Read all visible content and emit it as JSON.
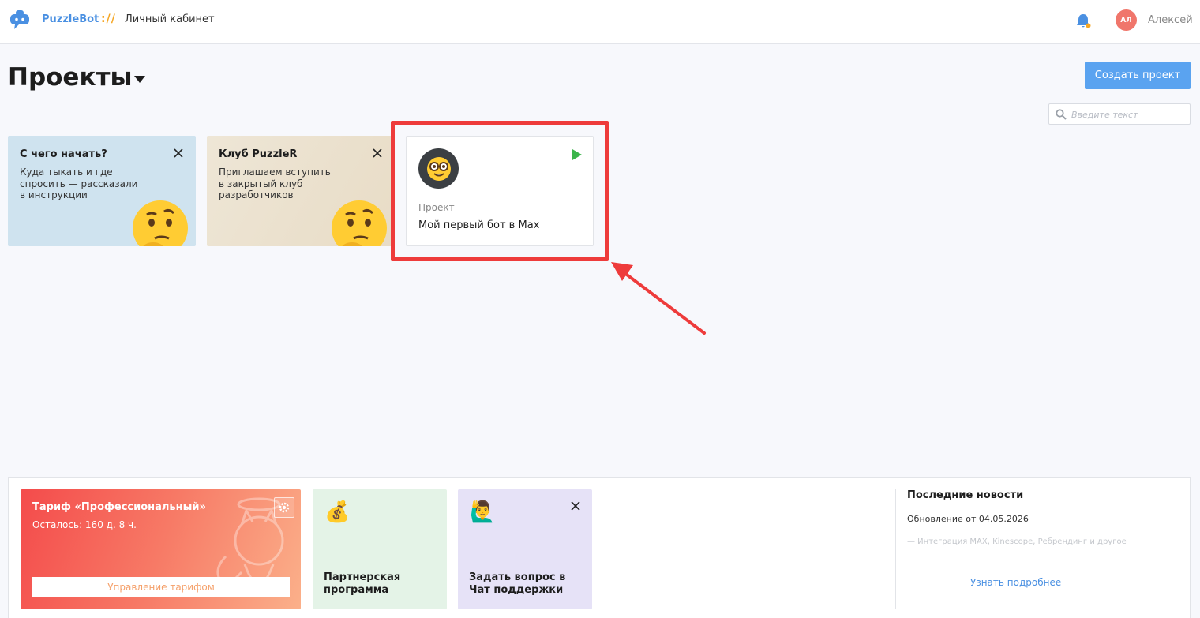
{
  "header": {
    "brand": "PuzzleBot",
    "separator": "://",
    "breadcrumb": "Личный кабинет",
    "avatar_initials": "АЛ",
    "username": "Алексей",
    "accent": "#4a90e2",
    "bell_badge_color": "#f5a623"
  },
  "main": {
    "title": "Проекты",
    "create_button": "Создать проект",
    "search_placeholder": "Введите текст"
  },
  "promos": [
    {
      "title": "С чего начать?",
      "text": "Куда тыкать и где спросить — рассказали в инструкции",
      "icon": "thinking-face"
    },
    {
      "title": "Клуб PuzzleR",
      "text": "Приглашаем вступить в закрытый клуб разработчиков",
      "icon": "thinking-face"
    }
  ],
  "project": {
    "label": "Проект",
    "name": "Мой первый бот в Max",
    "avatar_icon": "nerd-face",
    "status_icon": "play-icon",
    "status_color": "#3bb54a"
  },
  "bottom": {
    "tariff": {
      "title": "Тариф «Профессиональный»",
      "remaining": "Осталось: 160 д. 8 ч.",
      "button": "Управление тарифом"
    },
    "partner": {
      "emoji": "💰",
      "label": "Партнерская программа"
    },
    "support": {
      "emoji": "🙋‍♂️",
      "label": "Задать вопрос в Чат поддержки"
    },
    "news": {
      "title": "Последние новости",
      "date": "Обновление от 04.05.2026",
      "desc": "— Интеграция MAX, Kinescope, Ребрендинг и другое",
      "link": "Узнать подробнее"
    }
  },
  "annotation": {
    "highlight_color": "#ee3b3b"
  }
}
